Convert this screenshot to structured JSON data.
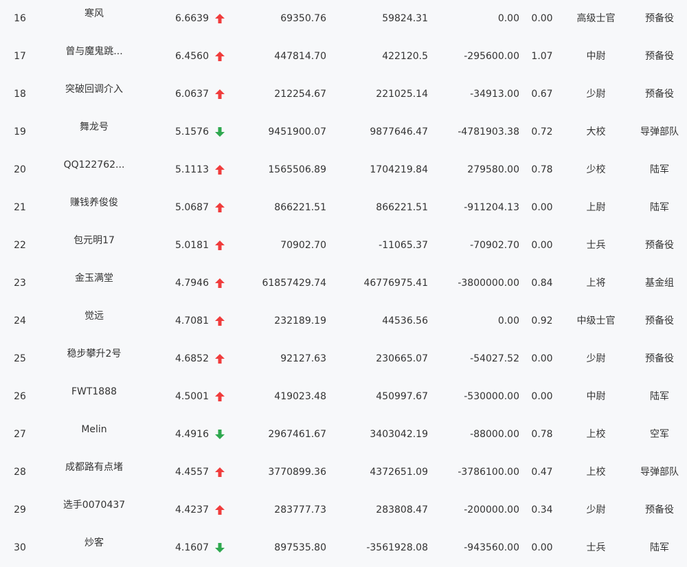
{
  "rows": [
    {
      "rank": "16",
      "name": "寒风",
      "rate": "6.6639",
      "trend": "up",
      "v1": "69350.76",
      "v2": "59824.31",
      "v3": "0.00",
      "ratio": "0.00",
      "military_rank": "高级士官",
      "branch": "预备役"
    },
    {
      "rank": "17",
      "name": "曾与魔鬼跳...",
      "rate": "6.4560",
      "trend": "up",
      "v1": "447814.70",
      "v2": "422120.5",
      "v3": "-295600.00",
      "ratio": "1.07",
      "military_rank": "中尉",
      "branch": "预备役"
    },
    {
      "rank": "18",
      "name": "突破回调介入",
      "rate": "6.0637",
      "trend": "up",
      "v1": "212254.67",
      "v2": "221025.14",
      "v3": "-34913.00",
      "ratio": "0.67",
      "military_rank": "少尉",
      "branch": "预备役"
    },
    {
      "rank": "19",
      "name": "舞龙号",
      "rate": "5.1576",
      "trend": "down",
      "v1": "9451900.07",
      "v2": "9877646.47",
      "v3": "-4781903.38",
      "ratio": "0.72",
      "military_rank": "大校",
      "branch": "导弹部队"
    },
    {
      "rank": "20",
      "name": "QQ122762...",
      "rate": "5.1113",
      "trend": "up",
      "v1": "1565506.89",
      "v2": "1704219.84",
      "v3": "279580.00",
      "ratio": "0.78",
      "military_rank": "少校",
      "branch": "陆军"
    },
    {
      "rank": "21",
      "name": "赚钱养俊俊",
      "rate": "5.0687",
      "trend": "up",
      "v1": "866221.51",
      "v2": "866221.51",
      "v3": "-911204.13",
      "ratio": "0.00",
      "military_rank": "上尉",
      "branch": "陆军"
    },
    {
      "rank": "22",
      "name": "包元明17",
      "rate": "5.0181",
      "trend": "up",
      "v1": "70902.70",
      "v2": "-11065.37",
      "v3": "-70902.70",
      "ratio": "0.00",
      "military_rank": "士兵",
      "branch": "预备役"
    },
    {
      "rank": "23",
      "name": "金玉满堂",
      "rate": "4.7946",
      "trend": "up",
      "v1": "61857429.74",
      "v2": "46776975.41",
      "v3": "-3800000.00",
      "ratio": "0.84",
      "military_rank": "上将",
      "branch": "基金组"
    },
    {
      "rank": "24",
      "name": "觉远",
      "rate": "4.7081",
      "trend": "up",
      "v1": "232189.19",
      "v2": "44536.56",
      "v3": "0.00",
      "ratio": "0.92",
      "military_rank": "中级士官",
      "branch": "预备役"
    },
    {
      "rank": "25",
      "name": "稳步攀升2号",
      "rate": "4.6852",
      "trend": "up",
      "v1": "92127.63",
      "v2": "230665.07",
      "v3": "-54027.52",
      "ratio": "0.00",
      "military_rank": "少尉",
      "branch": "预备役"
    },
    {
      "rank": "26",
      "name": "FWT1888",
      "rate": "4.5001",
      "trend": "up",
      "v1": "419023.48",
      "v2": "450997.67",
      "v3": "-530000.00",
      "ratio": "0.00",
      "military_rank": "中尉",
      "branch": "陆军"
    },
    {
      "rank": "27",
      "name": "Melin",
      "rate": "4.4916",
      "trend": "down",
      "v1": "2967461.67",
      "v2": "3403042.19",
      "v3": "-88000.00",
      "ratio": "0.78",
      "military_rank": "上校",
      "branch": "空军"
    },
    {
      "rank": "28",
      "name": "成都路有点堵",
      "rate": "4.4557",
      "trend": "up",
      "v1": "3770899.36",
      "v2": "4372651.09",
      "v3": "-3786100.00",
      "ratio": "0.47",
      "military_rank": "上校",
      "branch": "导弹部队"
    },
    {
      "rank": "29",
      "name": "选手0070437",
      "rate": "4.4237",
      "trend": "up",
      "v1": "283777.73",
      "v2": "283808.47",
      "v3": "-200000.00",
      "ratio": "0.34",
      "military_rank": "少尉",
      "branch": "预备役"
    },
    {
      "rank": "30",
      "name": "炒客",
      "rate": "4.1607",
      "trend": "down",
      "v1": "897535.80",
      "v2": "-3561928.08",
      "v3": "-943560.00",
      "ratio": "0.00",
      "military_rank": "士兵",
      "branch": "陆军"
    }
  ],
  "colors": {
    "up": "#f03c3c",
    "down": "#2fa84f",
    "text": "#333333",
    "background": "#f7f8fa"
  },
  "icons": {
    "up": "arrow-up-icon",
    "down": "arrow-down-icon"
  }
}
